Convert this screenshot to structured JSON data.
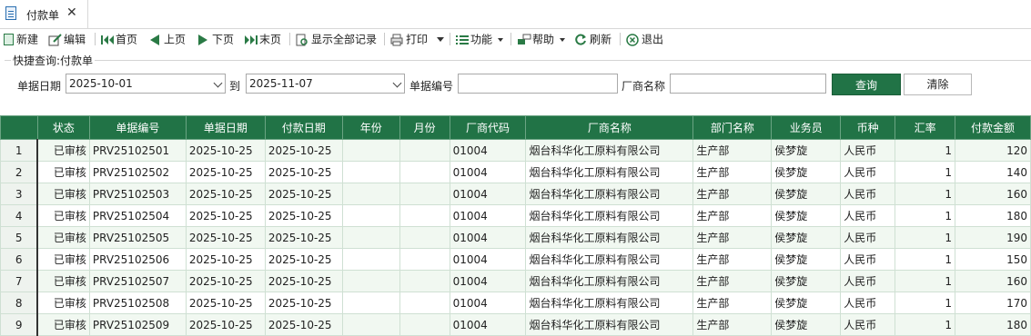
{
  "tab": {
    "label": "付款单"
  },
  "toolbar": {
    "new": "新建",
    "edit": "编辑",
    "first": "首页",
    "prev": "上页",
    "next": "下页",
    "last": "末页",
    "show_all": "显示全部记录",
    "print": "打印",
    "function": "功能",
    "help": "帮助",
    "refresh": "刷新",
    "exit": "退出"
  },
  "quick_search": {
    "title": "快捷查询:付款单",
    "date_label": "单据日期",
    "date_from": "2025-10-01",
    "to_label": "到",
    "date_to": "2025-11-07",
    "bill_no_label": "单据编号",
    "bill_no_value": "",
    "vendor_label": "厂商名称",
    "vendor_value": "",
    "query_button": "查询",
    "clear_button": "清除"
  },
  "table": {
    "columns": [
      "状态",
      "单据编号",
      "单据日期",
      "付款日期",
      "年份",
      "月份",
      "厂商代码",
      "厂商名称",
      "部门名称",
      "业务员",
      "币种",
      "汇率",
      "付款金额"
    ],
    "rows": [
      {
        "n": "1",
        "status": "已审核",
        "bill_no": "PRV25102501",
        "bill_date": "2025-10-25",
        "pay_date": "2025-10-25",
        "year": "",
        "month": "",
        "vendor_code": "01004",
        "vendor_name": "烟台科华化工原料有限公司",
        "dept": "生产部",
        "staff": "侯梦旋",
        "currency": "人民币",
        "rate": "1",
        "amount": "120"
      },
      {
        "n": "2",
        "status": "已审核",
        "bill_no": "PRV25102502",
        "bill_date": "2025-10-25",
        "pay_date": "2025-10-25",
        "year": "",
        "month": "",
        "vendor_code": "01004",
        "vendor_name": "烟台科华化工原料有限公司",
        "dept": "生产部",
        "staff": "侯梦旋",
        "currency": "人民币",
        "rate": "1",
        "amount": "140"
      },
      {
        "n": "3",
        "status": "已审核",
        "bill_no": "PRV25102503",
        "bill_date": "2025-10-25",
        "pay_date": "2025-10-25",
        "year": "",
        "month": "",
        "vendor_code": "01004",
        "vendor_name": "烟台科华化工原料有限公司",
        "dept": "生产部",
        "staff": "侯梦旋",
        "currency": "人民币",
        "rate": "1",
        "amount": "160"
      },
      {
        "n": "4",
        "status": "已审核",
        "bill_no": "PRV25102504",
        "bill_date": "2025-10-25",
        "pay_date": "2025-10-25",
        "year": "",
        "month": "",
        "vendor_code": "01004",
        "vendor_name": "烟台科华化工原料有限公司",
        "dept": "生产部",
        "staff": "侯梦旋",
        "currency": "人民币",
        "rate": "1",
        "amount": "180"
      },
      {
        "n": "5",
        "status": "已审核",
        "bill_no": "PRV25102505",
        "bill_date": "2025-10-25",
        "pay_date": "2025-10-25",
        "year": "",
        "month": "",
        "vendor_code": "01004",
        "vendor_name": "烟台科华化工原料有限公司",
        "dept": "生产部",
        "staff": "侯梦旋",
        "currency": "人民币",
        "rate": "1",
        "amount": "190"
      },
      {
        "n": "6",
        "status": "已审核",
        "bill_no": "PRV25102506",
        "bill_date": "2025-10-25",
        "pay_date": "2025-10-25",
        "year": "",
        "month": "",
        "vendor_code": "01004",
        "vendor_name": "烟台科华化工原料有限公司",
        "dept": "生产部",
        "staff": "侯梦旋",
        "currency": "人民币",
        "rate": "1",
        "amount": "150"
      },
      {
        "n": "7",
        "status": "已审核",
        "bill_no": "PRV25102507",
        "bill_date": "2025-10-25",
        "pay_date": "2025-10-25",
        "year": "",
        "month": "",
        "vendor_code": "01004",
        "vendor_name": "烟台科华化工原料有限公司",
        "dept": "生产部",
        "staff": "侯梦旋",
        "currency": "人民币",
        "rate": "1",
        "amount": "160"
      },
      {
        "n": "8",
        "status": "已审核",
        "bill_no": "PRV25102508",
        "bill_date": "2025-10-25",
        "pay_date": "2025-10-25",
        "year": "",
        "month": "",
        "vendor_code": "01004",
        "vendor_name": "烟台科华化工原料有限公司",
        "dept": "生产部",
        "staff": "侯梦旋",
        "currency": "人民币",
        "rate": "1",
        "amount": "170"
      },
      {
        "n": "9",
        "status": "已审核",
        "bill_no": "PRV25102509",
        "bill_date": "2025-10-25",
        "pay_date": "2025-10-25",
        "year": "",
        "month": "",
        "vendor_code": "01004",
        "vendor_name": "烟台科华化工原料有限公司",
        "dept": "生产部",
        "staff": "侯梦旋",
        "currency": "人民币",
        "rate": "1",
        "amount": "180"
      }
    ]
  },
  "colors": {
    "header_green": "#217346",
    "row_alt": "#f1f8f1"
  }
}
